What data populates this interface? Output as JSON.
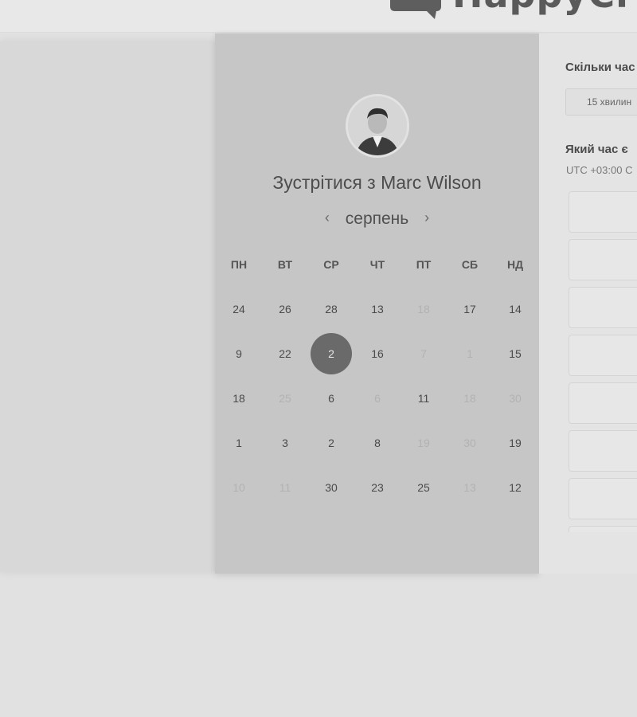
{
  "header": {
    "logo_text": "HappyCl"
  },
  "meeting": {
    "title": "Зустрітися з Marc Wilson",
    "avatar_icon": "person-avatar"
  },
  "calendar": {
    "month": "серпень",
    "prev_icon": "chevron-left-icon",
    "next_icon": "chevron-right-icon",
    "weekdays": [
      "ПН",
      "ВТ",
      "СР",
      "ЧТ",
      "ПТ",
      "СБ",
      "НД"
    ],
    "weeks": [
      [
        {
          "d": "24",
          "dim": false
        },
        {
          "d": "26",
          "dim": false
        },
        {
          "d": "28",
          "dim": false
        },
        {
          "d": "13",
          "dim": false
        },
        {
          "d": "18",
          "dim": true
        },
        {
          "d": "17",
          "dim": false
        },
        {
          "d": "14",
          "dim": false
        }
      ],
      [
        {
          "d": "9",
          "dim": false
        },
        {
          "d": "22",
          "dim": false
        },
        {
          "d": "2",
          "dim": false,
          "selected": true
        },
        {
          "d": "16",
          "dim": false
        },
        {
          "d": "7",
          "dim": true
        },
        {
          "d": "1",
          "dim": true
        },
        {
          "d": "15",
          "dim": false
        }
      ],
      [
        {
          "d": "18",
          "dim": false
        },
        {
          "d": "25",
          "dim": true
        },
        {
          "d": "6",
          "dim": false
        },
        {
          "d": "6",
          "dim": true
        },
        {
          "d": "11",
          "dim": false
        },
        {
          "d": "18",
          "dim": true
        },
        {
          "d": "30",
          "dim": true
        }
      ],
      [
        {
          "d": "1",
          "dim": false
        },
        {
          "d": "3",
          "dim": false
        },
        {
          "d": "2",
          "dim": false
        },
        {
          "d": "8",
          "dim": false
        },
        {
          "d": "19",
          "dim": true
        },
        {
          "d": "30",
          "dim": true
        },
        {
          "d": "19",
          "dim": false
        }
      ],
      [
        {
          "d": "10",
          "dim": true
        },
        {
          "d": "11",
          "dim": true
        },
        {
          "d": "30",
          "dim": false
        },
        {
          "d": "23",
          "dim": false
        },
        {
          "d": "25",
          "dim": false
        },
        {
          "d": "13",
          "dim": true
        },
        {
          "d": "12",
          "dim": false
        }
      ]
    ],
    "selected_color": "#6a6a6a"
  },
  "booking": {
    "duration_question": "Скільки час",
    "duration_value": "15 хвилин",
    "time_question": "Який час є",
    "timezone": "UTC +03:00 С",
    "slot_count_visible": 8
  }
}
